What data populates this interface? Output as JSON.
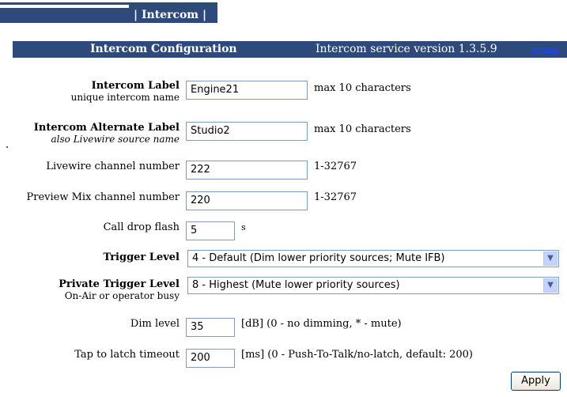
{
  "nav": {
    "tab_label": "| Intercom |"
  },
  "header": {
    "title": "Intercom Configuration",
    "version": "Intercom service version 1.3.5.9",
    "upgrade_link": "upgrade"
  },
  "form": {
    "intercom_label": {
      "label": "Intercom Label",
      "sublabel": "unique intercom name",
      "value": "Engine21",
      "note": "max 10 characters"
    },
    "alternate_label": {
      "label": "Intercom Alternate Label",
      "sublabel": "also Livewire source name",
      "value": "Studio2",
      "note": "max 10 characters"
    },
    "livewire_channel": {
      "label": "Livewire channel number",
      "value": "222",
      "note": "1-32767"
    },
    "preview_mix_channel": {
      "label": "Preview Mix channel number",
      "value": "220",
      "note": "1-32767"
    },
    "call_drop_flash": {
      "label": "Call drop flash",
      "value": "5",
      "note": "s"
    },
    "trigger_level": {
      "label": "Trigger Level",
      "value": "4 - Default (Dim lower priority sources; Mute IFB)"
    },
    "private_trigger_level": {
      "label": "Private Trigger Level",
      "sublabel": "On-Air or operator busy",
      "value": "8 - Highest (Mute lower priority sources)"
    },
    "dim_level": {
      "label": "Dim level",
      "value": "35",
      "note": "[dB] (0 - no dimming, * - mute)"
    },
    "tap_to_latch": {
      "label": "Tap to latch timeout",
      "value": "200",
      "note": "[ms] (0 - Push-To-Talk/no-latch, default: 200)"
    }
  },
  "actions": {
    "apply_label": "Apply"
  },
  "colors": {
    "nav_bg": "#2e4a7a",
    "title_bg": "#2e4a7a",
    "upgrade_link": "#2244ff"
  }
}
